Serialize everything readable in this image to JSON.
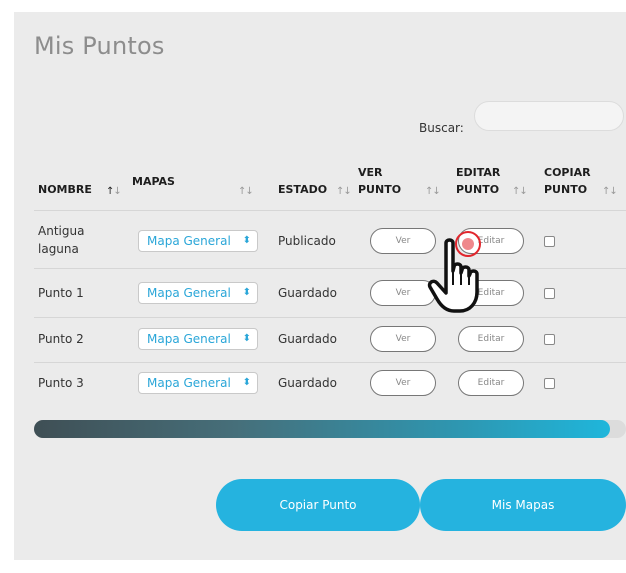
{
  "title": "Mis Puntos",
  "search": {
    "label": "Buscar:",
    "placeholder": ""
  },
  "table": {
    "headers": {
      "nombre": "NOMBRE",
      "mapas": "MAPAS",
      "estado": "ESTADO",
      "ver_punto": [
        "VER",
        "PUNTO"
      ],
      "editar_punto": [
        "EDITAR",
        "PUNTO"
      ],
      "copiar_punto": [
        "COPIAR",
        "PUNTO"
      ]
    },
    "sort_icon": "↑↓",
    "rows": [
      {
        "nombre": [
          "Antigua",
          "laguna"
        ],
        "mapa": "Mapa General",
        "estado": "Publicado",
        "ver": "Ver",
        "editar": "Editar",
        "copiar_checked": false
      },
      {
        "nombre": [
          "Punto 1"
        ],
        "mapa": "Mapa General",
        "estado": "Guardado",
        "ver": "Ver",
        "editar": "Editar",
        "copiar_checked": false
      },
      {
        "nombre": [
          "Punto 2"
        ],
        "mapa": "Mapa General",
        "estado": "Guardado",
        "ver": "Ver",
        "editar": "Editar",
        "copiar_checked": false
      },
      {
        "nombre": [
          "Punto 3"
        ],
        "mapa": "Mapa General",
        "estado": "Guardado",
        "ver": "Ver",
        "editar": "Editar",
        "copiar_checked": false
      }
    ]
  },
  "select_arrows": "⬍",
  "buttons": {
    "copiar": "Copiar Punto",
    "mis_mapas": "Mis Mapas"
  },
  "colors": {
    "accent": "#25b3df",
    "select_text": "#2aa6d8",
    "click_indicator": "#e1262d"
  },
  "icons": {
    "cursor": "hand-pointer-icon",
    "click": "click-indicator-icon"
  }
}
